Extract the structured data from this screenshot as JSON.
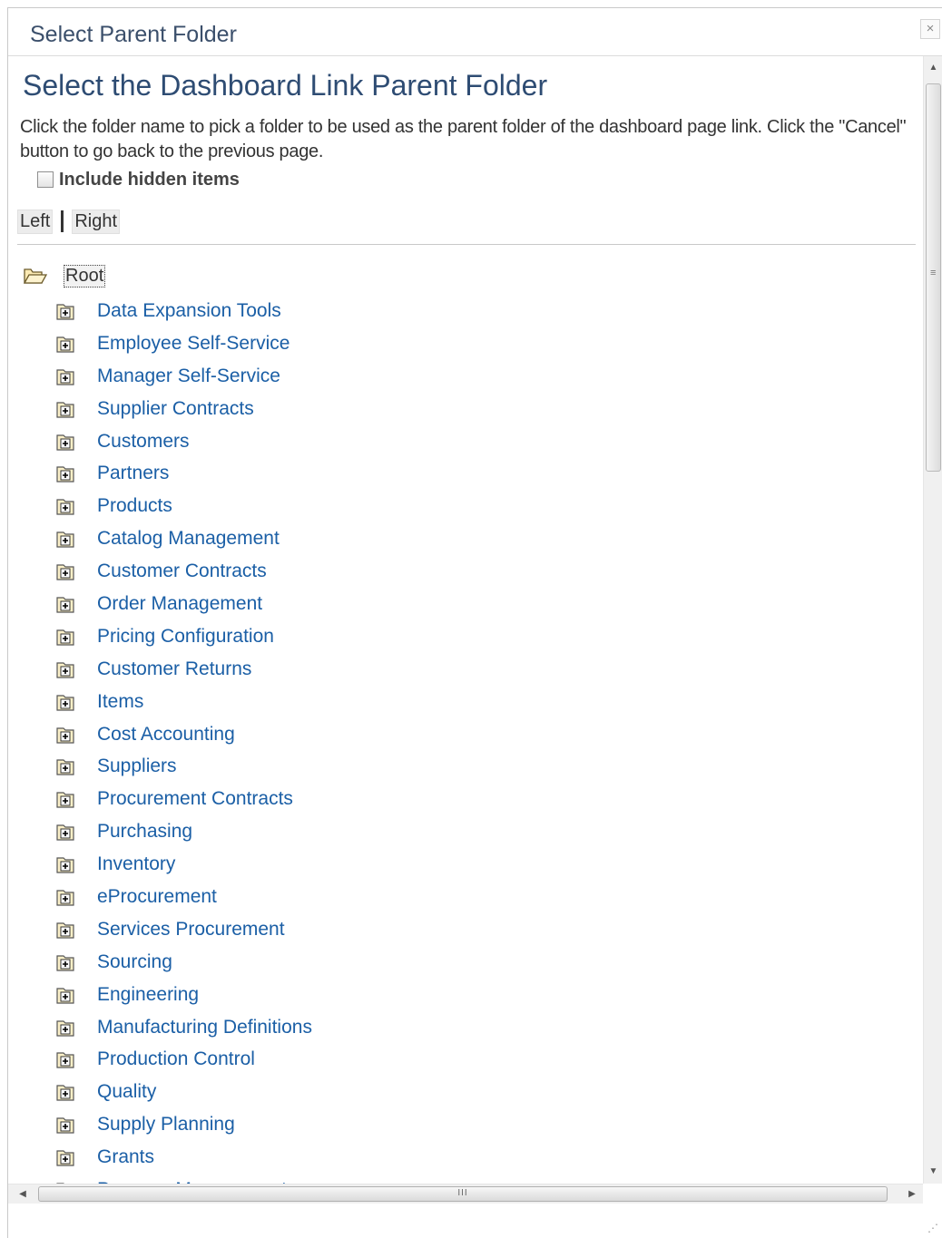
{
  "dialog": {
    "title": "Select Parent Folder",
    "close_label": "×"
  },
  "page": {
    "heading": "Select the Dashboard Link Parent Folder",
    "instructions": "Click the folder name to pick a folder to be used as the parent folder of the dashboard page link.  Click the \"Cancel\" button to go back to the previous page.",
    "include_hidden_label": "Include hidden items",
    "include_hidden_checked": false,
    "left_label": "Left",
    "right_label": "Right"
  },
  "tree": {
    "root_label": "Root",
    "folders": [
      "Data Expansion Tools",
      "Employee Self-Service",
      "Manager Self-Service",
      "Supplier Contracts",
      "Customers",
      "Partners",
      "Products",
      "Catalog Management",
      "Customer Contracts",
      "Order Management",
      "Pricing Configuration",
      "Customer Returns",
      "Items",
      "Cost Accounting",
      "Suppliers",
      "Procurement Contracts",
      "Purchasing",
      "Inventory",
      "eProcurement",
      "Services Procurement",
      "Sourcing",
      "Engineering",
      "Manufacturing Definitions",
      "Production Control",
      "Quality",
      "Supply Planning",
      "Grants",
      "Program Management"
    ]
  },
  "scrollbars": {
    "up_arrow": "▲",
    "down_arrow": "▼",
    "left_arrow": "◀",
    "right_arrow": "▶",
    "grip": "III"
  },
  "colors": {
    "link": "#1b5fa6",
    "heading": "#2e4c73",
    "title": "#3b4f6b"
  }
}
